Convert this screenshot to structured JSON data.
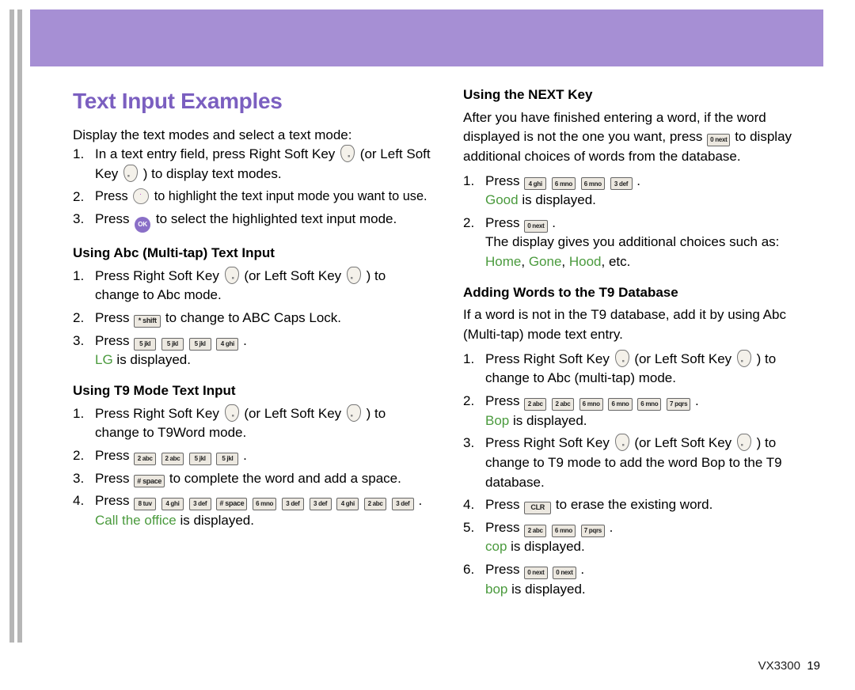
{
  "title": "Text Input Examples",
  "intro": "Display the text modes and select a text mode:",
  "left": {
    "steps1": [
      {
        "pre": "In a text entry field, press Right Soft Key ",
        "mid1": " (or Left Soft Key ",
        "mid2": " ) to display text modes."
      },
      {
        "pre": "Press ",
        "post": " to highlight the text input mode you want to use."
      },
      {
        "pre": "Press ",
        "post": " to select the highlighted text input mode."
      }
    ],
    "sub_abc": "Using Abc (Multi-tap) Text Input",
    "abc": {
      "s1a": "Press Right Soft Key ",
      "s1b": " (or Left Soft Key ",
      "s1c": " ) to change to Abc mode.",
      "s2a": "Press ",
      "s2b": " to change to ABC Caps Lock.",
      "s3a": "Press ",
      "s3b": ".",
      "s3disp": "LG",
      "s3after": " is displayed."
    },
    "sub_t9": "Using T9 Mode Text Input",
    "t9": {
      "s1a": "Press Right Soft Key ",
      "s1b": " (or Left Soft Key ",
      "s1c": " ) to change to T9Word mode.",
      "s2a": "Press ",
      "s2b": ".",
      "s3a": "Press ",
      "s3b": " to complete the word and add a space.",
      "s4a": "Press ",
      "s4b": ".",
      "s4disp": "Call the office",
      "s4after": " is displayed."
    }
  },
  "right": {
    "sub_next": "Using the NEXT Key",
    "next_intro1": "After you have finished entering a word, if the word displayed is not the one you want, press ",
    "next_intro2": " to display additional choices of words from the database.",
    "next": {
      "s1a": "Press ",
      "s1b": ".",
      "s1disp": "Good",
      "s1after": " is displayed.",
      "s2a": "Press ",
      "s2b": ".",
      "s2line": "The display gives you additional choices such as:",
      "s2words": [
        "Home",
        "Gone",
        "Hood"
      ],
      "s2etc": ", etc."
    },
    "sub_add": "Adding Words to the T9 Database",
    "add_intro": "If a word is not in the T9 database, add it by using Abc (Multi-tap) mode text entry.",
    "add": {
      "s1a": "Press Right Soft Key ",
      "s1b": " (or Left Soft Key ",
      "s1c": " ) to change to Abc (multi-tap) mode.",
      "s2a": "Press ",
      "s2b": ".",
      "s2disp": "Bop",
      "s2after": " is displayed.",
      "s3a": "Press Right Soft Key ",
      "s3b": " (or Left Soft Key ",
      "s3c": " ) to change to T9 mode to add the word Bop to the T9 database.",
      "s4a": "Press ",
      "s4b": " to erase the existing word.",
      "s5a": "Press ",
      "s5b": ".",
      "s5disp": "cop",
      "s5after": " is displayed.",
      "s6a": "Press ",
      "s6b": ".",
      "s6disp": "bop",
      "s6after": " is displayed."
    }
  },
  "keys": {
    "0": "0 next",
    "2": "2 abc",
    "3": "3 def",
    "4": "4 ghi",
    "5": "5 jkl",
    "6": "6 mno",
    "7": "7 pqrs",
    "8": "8 tuv",
    "star": "* shift",
    "hash": "# space",
    "clr": "CLR",
    "ok": "OK"
  },
  "footer": {
    "model": "VX3300",
    "page": "19"
  }
}
